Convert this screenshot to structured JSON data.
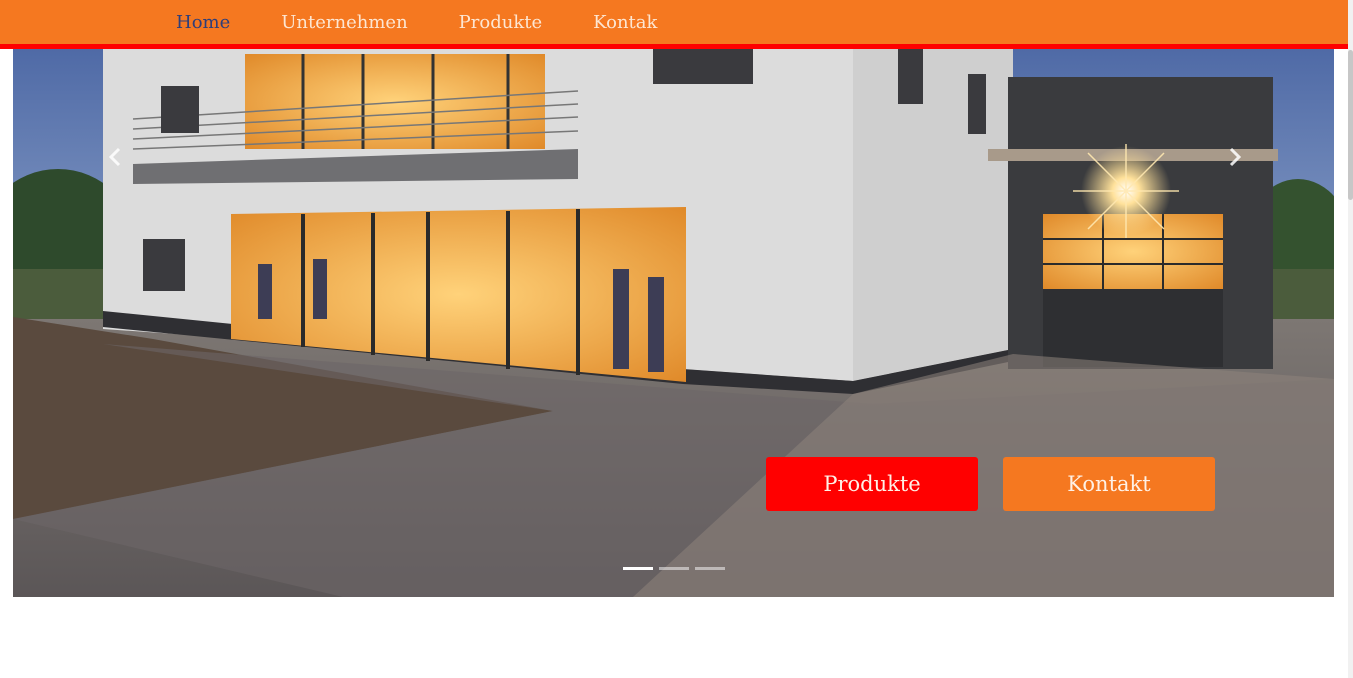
{
  "nav": {
    "items": [
      {
        "label": "Home",
        "active": true
      },
      {
        "label": "Unternehmen",
        "active": false
      },
      {
        "label": "Produkte",
        "active": false
      },
      {
        "label": "Kontak",
        "active": false
      }
    ]
  },
  "hero": {
    "image": "photo of a modern office and showroom building at dusk with illuminated glass front, balcony and an open garage door, paved driveway in front",
    "prev_icon": "chevron-left-icon",
    "next_icon": "chevron-right-icon",
    "buttons": {
      "produkte": "Produkte",
      "kontakt": "Kontakt"
    },
    "slide_count": 3,
    "active_slide": 1
  },
  "colors": {
    "brand_orange": "#f57820",
    "accent_red": "#ff0000",
    "nav_text": "#fde6d2",
    "nav_active": "#2e3e7a"
  }
}
